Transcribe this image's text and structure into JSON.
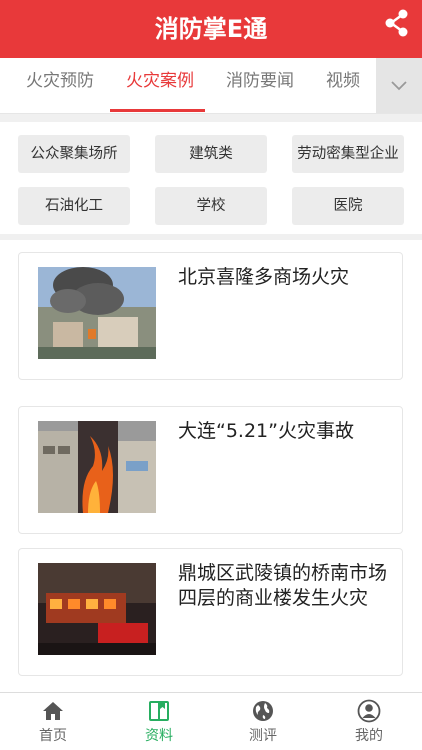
{
  "header": {
    "title": "消防掌E通",
    "share_icon": "share-icon"
  },
  "tabs": [
    {
      "label": "火灾预防",
      "active": false
    },
    {
      "label": "火灾案例",
      "active": true
    },
    {
      "label": "消防要闻",
      "active": false
    },
    {
      "label": "视频",
      "active": false
    }
  ],
  "tab_more_icon": "chevron-down-icon",
  "filters": [
    "公众聚集场所",
    "建筑类",
    "劳动密集型企业",
    "石油化工",
    "学校",
    "医院"
  ],
  "cases": [
    {
      "title": "北京喜隆多商场火灾"
    },
    {
      "title": "大连“5.21”火灾事故"
    },
    {
      "title": "鼎城区武陵镇的桥南市场四层的商业楼发生火灾"
    }
  ],
  "nav": [
    {
      "label": "首页",
      "icon": "home-icon",
      "active": false
    },
    {
      "label": "资料",
      "icon": "book-icon",
      "active": true
    },
    {
      "label": "测评",
      "icon": "globe-icon",
      "active": false
    },
    {
      "label": "我的",
      "icon": "user-icon",
      "active": false
    }
  ],
  "colors": {
    "brand_red": "#e8393a",
    "active_green": "#27ae60"
  }
}
